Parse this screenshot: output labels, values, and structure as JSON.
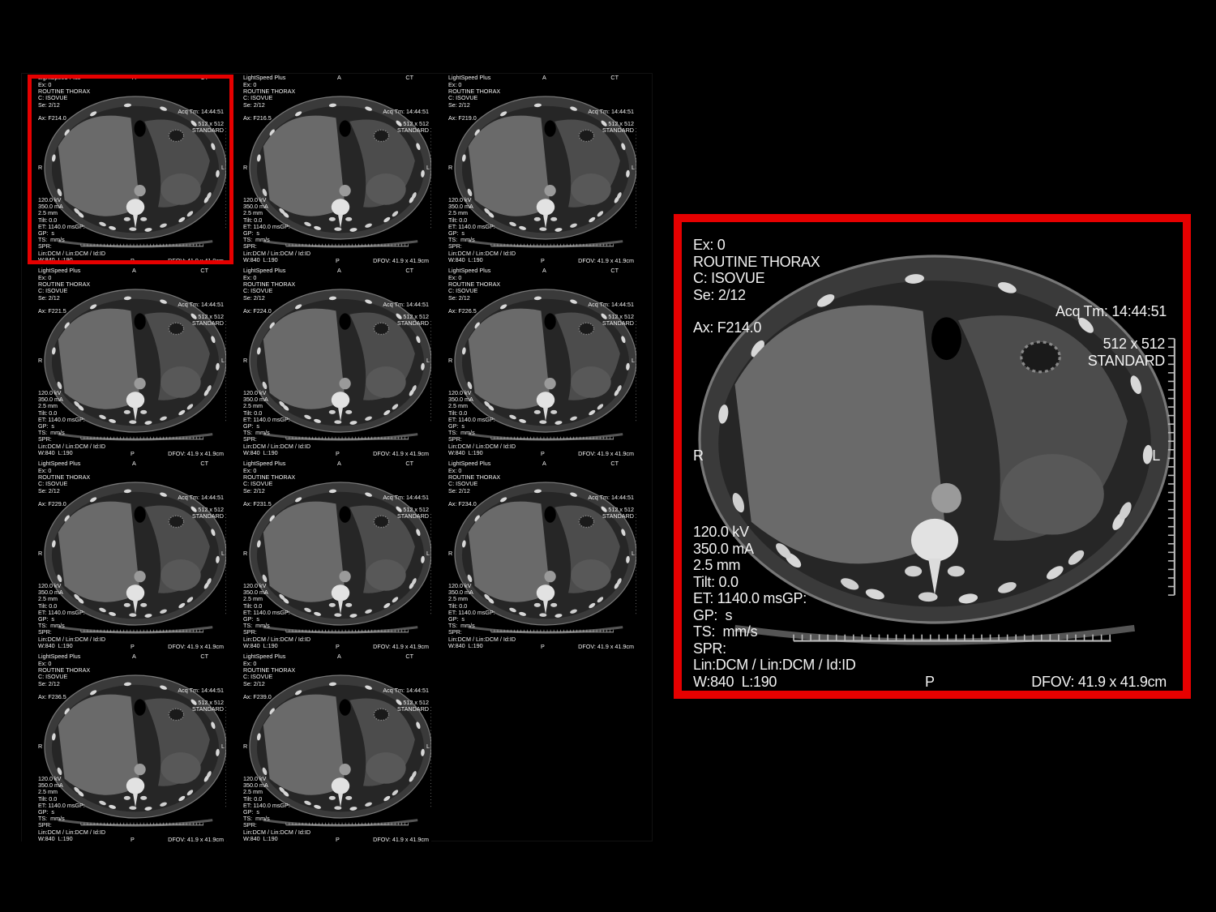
{
  "scanner": "LightSpeed Plus",
  "orientation": {
    "anterior": "A",
    "posterior": "P",
    "right": "R",
    "left": "L",
    "modality": "CT"
  },
  "exam": "Ex: 0",
  "protocol": "ROUTINE THORAX",
  "contrast": "C: ISOVUE",
  "series": "Se: 2/12",
  "acq_time": "Acq Tm: 14:44:51",
  "matrix": "512 x 512",
  "kernel": "STANDARD",
  "params": [
    "120.0 kV",
    "350.0 mA",
    "2.5 mm",
    "Tilt: 0.0",
    "ET: 1140.0 msGP:",
    "GP:  s",
    "TS:  mm/s",
    "SPR:",
    "Lin:DCM / Lin:DCM / Id:ID",
    "W:840  L:190"
  ],
  "dfov": "DFOV: 41.9 x 41.9cm",
  "highlight_color": "#e60000",
  "tiles": [
    {
      "ax": "Ax: F214.0"
    },
    {
      "ax": "Ax: F216.5"
    },
    {
      "ax": "Ax: F219.0"
    },
    {
      "ax": "Ax: F221.5"
    },
    {
      "ax": "Ax: F224.0"
    },
    {
      "ax": "Ax: F226.5"
    },
    {
      "ax": "Ax: F229.0"
    },
    {
      "ax": "Ax: F231.5"
    },
    {
      "ax": "Ax: F234.0"
    },
    {
      "ax": "Ax: F236.5"
    },
    {
      "ax": "Ax: F239.0"
    }
  ],
  "zoom": {
    "exam": "Ex: 0",
    "protocol": "ROUTINE THORAX",
    "contrast": "C: ISOVUE",
    "series": "Se: 2/12",
    "ax": "Ax: F214.0",
    "acq_time": "Acq Tm: 14:44:51",
    "matrix": "512 x 512",
    "kernel": "STANDARD",
    "right": "R",
    "left": "L",
    "params": [
      "120.0 kV",
      "350.0 mA",
      "2.5 mm",
      "Tilt: 0.0",
      "ET: 1140.0 msGP:",
      "GP:  s",
      "TS:  mm/s",
      "SPR:",
      "Lin:DCM / Lin:DCM / Id:ID",
      "W:840  L:190"
    ],
    "posterior": "P",
    "dfov": "DFOV: 41.9 x 41.9cm"
  }
}
